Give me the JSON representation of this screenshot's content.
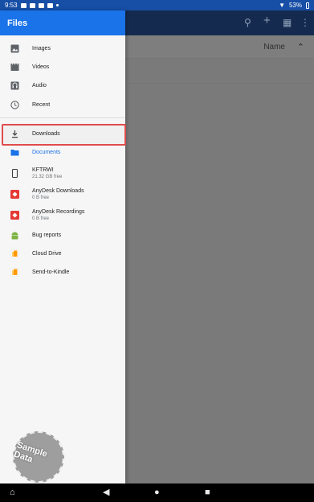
{
  "status_bar": {
    "time": "9:53",
    "battery": "53%"
  },
  "drawer": {
    "title": "Files",
    "items": [
      {
        "label": "Images",
        "sub": "",
        "icon": "image-icon"
      },
      {
        "label": "Videos",
        "sub": "",
        "icon": "video-icon"
      },
      {
        "label": "Audio",
        "sub": "",
        "icon": "audio-icon"
      },
      {
        "label": "Recent",
        "sub": "",
        "icon": "recent-icon"
      },
      {
        "label": "Downloads",
        "sub": "",
        "icon": "download-icon"
      },
      {
        "label": "Documents",
        "sub": "",
        "icon": "folder-icon"
      },
      {
        "label": "KFTRWI",
        "sub": "21.32 GB free",
        "icon": "device-icon"
      },
      {
        "label": "AnyDesk Downloads",
        "sub": "0 B free",
        "icon": "anydesk-icon"
      },
      {
        "label": "AnyDesk Recordings",
        "sub": "0 B free",
        "icon": "anydesk-icon"
      },
      {
        "label": "Bug reports",
        "sub": "",
        "icon": "android-icon"
      },
      {
        "label": "Cloud Drive",
        "sub": "",
        "icon": "cloud-drive-icon"
      },
      {
        "label": "Send-to-Kindle",
        "sub": "",
        "icon": "kindle-icon"
      }
    ],
    "selected": "Documents"
  },
  "sort": {
    "label": "Name"
  },
  "watermark": "Sample Data",
  "colors": {
    "header_blue": "#1a73e8",
    "selected_text": "#1a73e8",
    "highlight_border": "#e04c4c"
  }
}
